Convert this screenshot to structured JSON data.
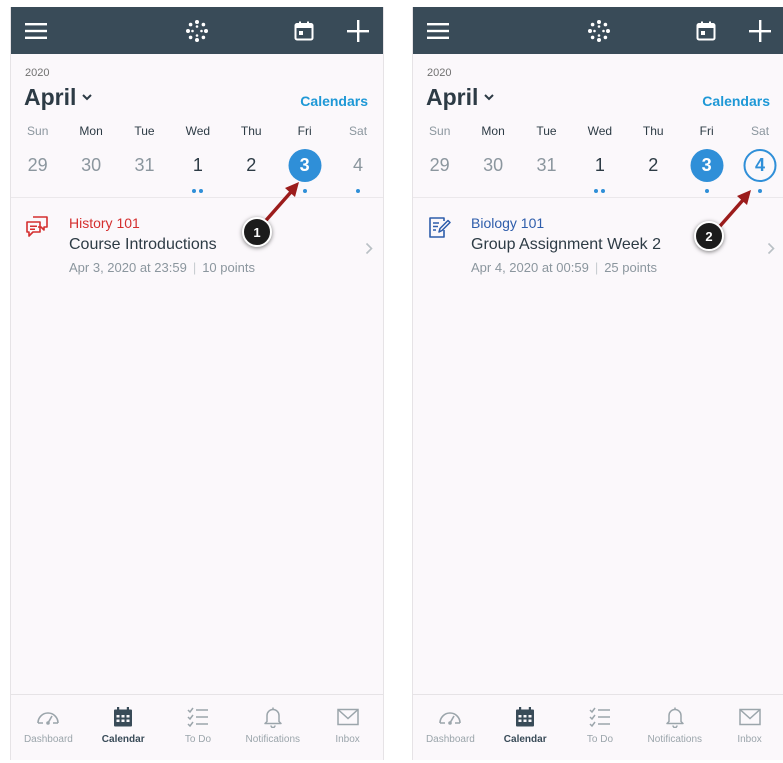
{
  "colors": {
    "topbar": "#394b58",
    "accent_blue": "#2f8fd8",
    "history_red": "#d42f2f",
    "biology_blue": "#2e5dab",
    "arrow_red": "#9c1c1c"
  },
  "screens": [
    {
      "year": "2020",
      "month": "April",
      "calendars_link": "Calendars",
      "weekdays": [
        "Sun",
        "Mon",
        "Tue",
        "Wed",
        "Thu",
        "Fri",
        "Sat"
      ],
      "days": [
        "29",
        "30",
        "31",
        "1",
        "2",
        "3",
        "4"
      ],
      "event": {
        "icon": "discussion-icon",
        "course": "History 101",
        "title": "Course Introductions",
        "date": "Apr 3, 2020 at 23:59",
        "points": "10 points"
      },
      "callout": "1"
    },
    {
      "year": "2020",
      "month": "April",
      "calendars_link": "Calendars",
      "weekdays": [
        "Sun",
        "Mon",
        "Tue",
        "Wed",
        "Thu",
        "Fri",
        "Sat"
      ],
      "days": [
        "29",
        "30",
        "31",
        "1",
        "2",
        "3",
        "4"
      ],
      "event": {
        "icon": "assignment-icon",
        "course": "Biology 101",
        "title": "Group Assignment Week 2",
        "date": "Apr 4, 2020 at 00:59",
        "points": "25 points"
      },
      "callout": "2"
    }
  ],
  "tabbar": {
    "dashboard": "Dashboard",
    "calendar": "Calendar",
    "todo": "To Do",
    "notifications": "Notifications",
    "inbox": "Inbox"
  }
}
